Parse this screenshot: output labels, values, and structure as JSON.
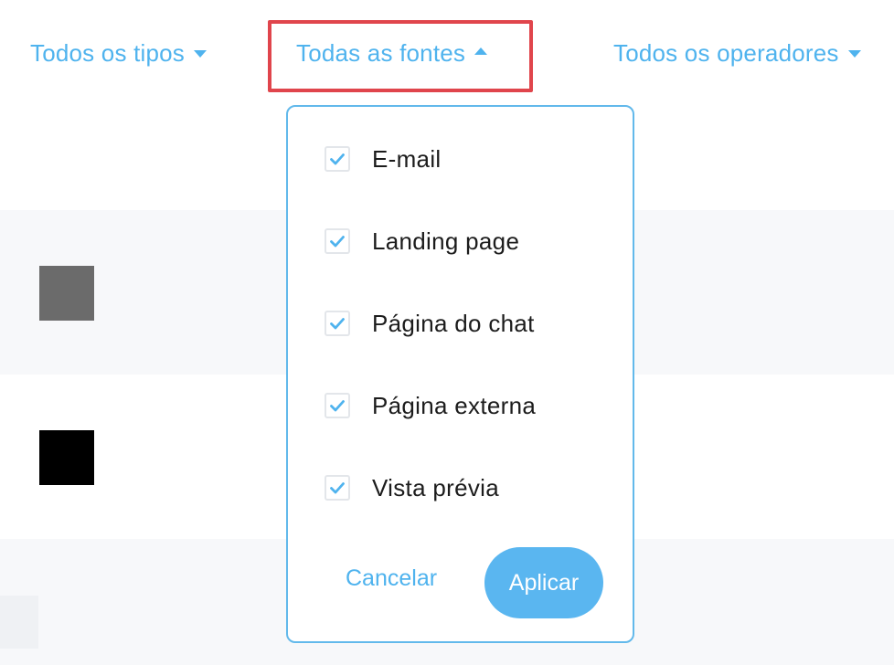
{
  "filters": {
    "types_label": "Todos os tipos",
    "sources_label": "Todas as fontes",
    "operators_label": "Todos os operadores"
  },
  "sources_dropdown": {
    "options": [
      {
        "label": "E-mail",
        "checked": true
      },
      {
        "label": "Landing page",
        "checked": true
      },
      {
        "label": "Página do chat",
        "checked": true
      },
      {
        "label": "Página externa",
        "checked": true
      },
      {
        "label": "Vista prévia",
        "checked": true
      }
    ],
    "cancel_label": "Cancelar",
    "apply_label": "Aplicar"
  },
  "colors": {
    "accent": "#4fb3ee",
    "apply_button": "#5ab6f0",
    "highlight": "#e0454c"
  }
}
